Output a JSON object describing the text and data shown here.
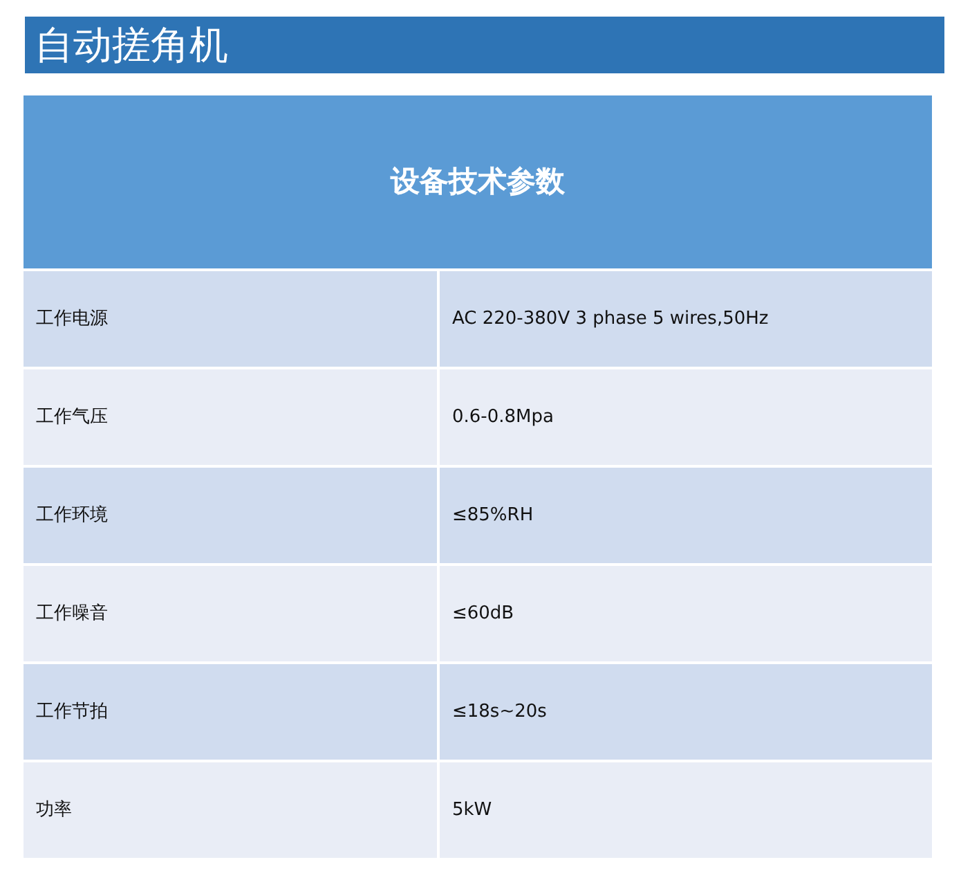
{
  "title": "自动搓角机",
  "table": {
    "heading": "设备技术参数",
    "rows": [
      {
        "label": "工作电源",
        "value": "AC 220-380V 3 phase 5 wires,50Hz"
      },
      {
        "label": "工作气压",
        "value": "0.6-0.8Mpa"
      },
      {
        "label": "工作环境",
        "value": "≤85%RH"
      },
      {
        "label": "工作噪音",
        "value": "≤60dB"
      },
      {
        "label": "工作节拍",
        "value": "≤18s~20s"
      },
      {
        "label": "功率",
        "value": "5kW"
      }
    ]
  }
}
